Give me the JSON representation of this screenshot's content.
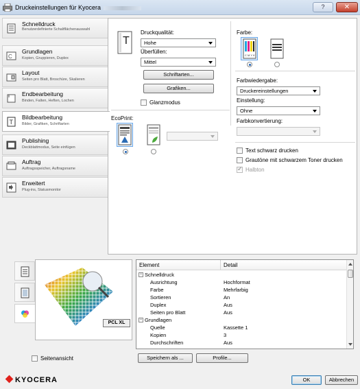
{
  "window": {
    "title": "Druckeinstellungen für Kyocera",
    "help_label": "?",
    "close_label": "✕"
  },
  "sidebar": {
    "items": [
      {
        "title": "Schnelldruck",
        "sub": "Benutzerdefinierte Schaltflächenauswahl",
        "icon": "quick-print-icon"
      },
      {
        "title": "Grundlagen",
        "sub": "Kopien, Gruppieren, Duplex",
        "icon": "basic-icon"
      },
      {
        "title": "Layout",
        "sub": "Seiten pro Blatt, Broschüre, Skalieren",
        "icon": "layout-icon"
      },
      {
        "title": "Endbearbeitung",
        "sub": "Binden, Falten, Heften, Lochen",
        "icon": "finishing-icon"
      },
      {
        "title": "Bildbearbeitung",
        "sub": "Bilder, Grafiken, Schriftarten",
        "icon": "imaging-icon"
      },
      {
        "title": "Publishing",
        "sub": "Deckblattmodus, Seite einfügen",
        "icon": "publishing-icon"
      },
      {
        "title": "Auftrag",
        "sub": "Auftragsspeicher, Auftragsname",
        "icon": "job-icon"
      },
      {
        "title": "Erweitert",
        "sub": "Plug-ins, Statusmonitor",
        "icon": "advanced-icon"
      }
    ],
    "active_index": 4
  },
  "imaging": {
    "print_quality_label": "Druckqualität:",
    "print_quality_value": "Hohe",
    "overprint_label": "Überfüllen:",
    "overprint_value": "Mittel",
    "fonts_button": "Schriftarten...",
    "graphics_button": "Grafiken...",
    "gloss_label": "Glanzmodus",
    "ecoprint_label": "EcoPrint:",
    "color_label": "Farbe:",
    "color_reproduction_label": "Farbwiedergabe:",
    "color_reproduction_value": "Druckereinstellungen",
    "setting_label": "Einstellung:",
    "setting_value": "Ohne",
    "color_conversion_label": "Farbkonvertierung:",
    "black_text_label": "Text schwarz drucken",
    "gray_black_toner_label": "Grautöne mit schwarzem Toner drucken",
    "halftone_label": "Halbton",
    "cmyk_label": "C M Y K"
  },
  "preview": {
    "pcl_label": "PCL XL",
    "page_view_label": "Seitenansicht"
  },
  "details": {
    "col_element": "Element",
    "col_detail": "Detail",
    "rows": [
      {
        "type": "group",
        "k": "Schnelldruck",
        "v": ""
      },
      {
        "type": "item",
        "k": "Ausrichtung",
        "v": "Hochformat"
      },
      {
        "type": "item",
        "k": "Farbe",
        "v": "Mehrfarbig"
      },
      {
        "type": "item",
        "k": "Sortieren",
        "v": "An"
      },
      {
        "type": "item",
        "k": "Duplex",
        "v": "Aus"
      },
      {
        "type": "item",
        "k": "Seiten pro Blatt",
        "v": "Aus"
      },
      {
        "type": "group",
        "k": "Grundlagen",
        "v": ""
      },
      {
        "type": "item",
        "k": "Quelle",
        "v": "Kassette 1"
      },
      {
        "type": "item",
        "k": "Kopien",
        "v": "3"
      },
      {
        "type": "item",
        "k": "Durchschriften",
        "v": "Aus"
      }
    ],
    "group_toggle": "−"
  },
  "buttons": {
    "save_as": "Speichern als ...",
    "profiles": "Profile...",
    "ok": "OK",
    "cancel": "Abbrechen"
  },
  "brand": {
    "logo_text": "KYOCERA"
  }
}
